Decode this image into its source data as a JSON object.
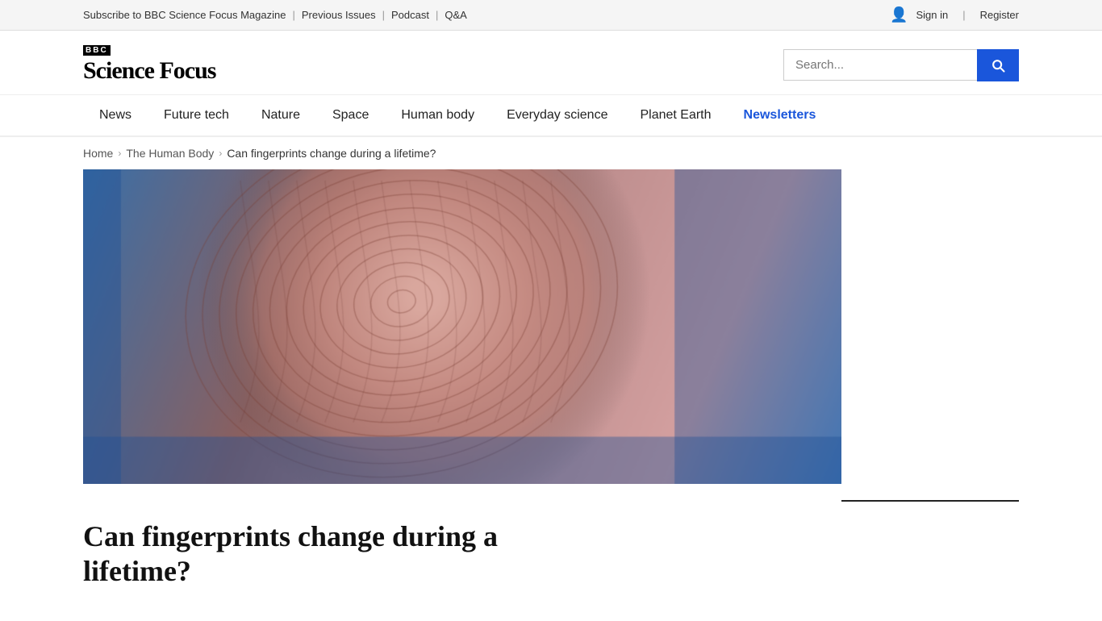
{
  "topbar": {
    "links": [
      {
        "label": "Subscribe to BBC Science Focus Magazine"
      },
      {
        "label": "Previous Issues"
      },
      {
        "label": "Podcast"
      },
      {
        "label": "Q&A"
      }
    ],
    "auth": {
      "signin": "Sign in",
      "register": "Register"
    }
  },
  "header": {
    "logo": {
      "bbc": "BBC",
      "title": "Science Focus"
    },
    "search": {
      "placeholder": "Search...",
      "button_label": "Search"
    }
  },
  "nav": {
    "items": [
      {
        "label": "News",
        "class": ""
      },
      {
        "label": "Future tech",
        "class": ""
      },
      {
        "label": "Nature",
        "class": ""
      },
      {
        "label": "Space",
        "class": ""
      },
      {
        "label": "Human body",
        "class": ""
      },
      {
        "label": "Everyday science",
        "class": ""
      },
      {
        "label": "Planet Earth",
        "class": ""
      },
      {
        "label": "Newsletters",
        "class": "newsletters"
      }
    ]
  },
  "breadcrumb": {
    "home": "Home",
    "section": "The Human Body",
    "current": "Can fingerprints change during a lifetime?"
  },
  "article": {
    "title_line1": "Can fingerprints change during a",
    "title_line2": "lifetime?"
  },
  "colors": {
    "search_btn": "#1a56db",
    "newsletters": "#1a56db"
  }
}
